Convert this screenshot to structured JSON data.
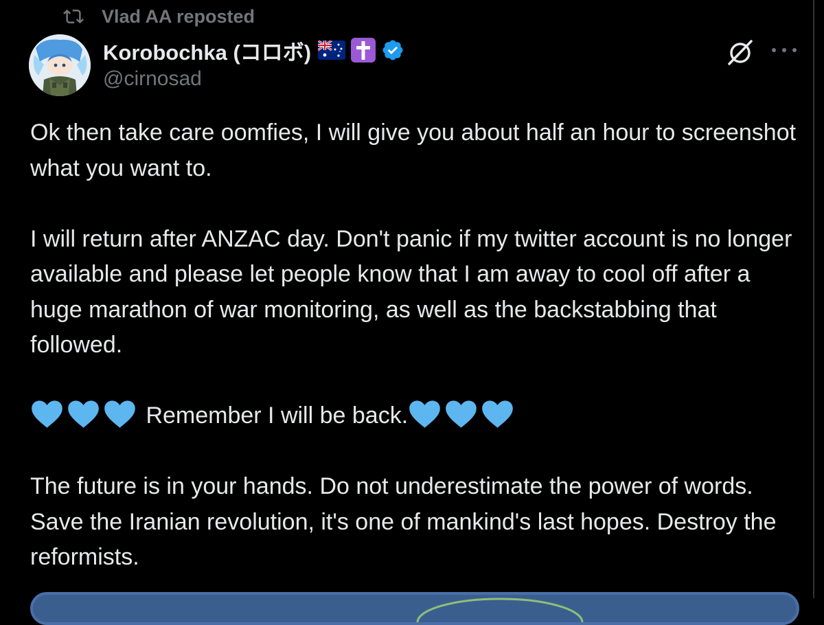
{
  "repost": {
    "label": "Vlad AA reposted",
    "icon": "repost-icon"
  },
  "author": {
    "display_name": "Korobochka (コロボ)",
    "handle": "@cirnosad",
    "badges": [
      "australia-flag-emoji",
      "latin-cross-emoji",
      "verified-badge-icon"
    ]
  },
  "actions": {
    "grok_icon": "grok-icon",
    "more_icon": "more-options-icon"
  },
  "post": {
    "paragraph1": "Ok then take care oomfies, I will give you about half an hour to screenshot what you want to.",
    "paragraph2": "I will return after ANZAC day. Don't panic if my twitter account is no longer available and please let people know that I am away to cool off after a huge marathon of war monitoring, as well as the backstabbing that followed.",
    "paragraph3_text": "Remember I will be back.",
    "paragraph3_emoji": "light-blue-heart-emoji",
    "paragraph4": "The future is in your hands. Do not underestimate the power of words. Save the Iranian revolution, it's one of mankind's last hopes. Destroy the reformists."
  },
  "colors": {
    "background": "#000000",
    "text": "#e7e9ea",
    "secondary": "#71767b",
    "verified": "#1d9bf0",
    "heart": "#5db6f0"
  }
}
